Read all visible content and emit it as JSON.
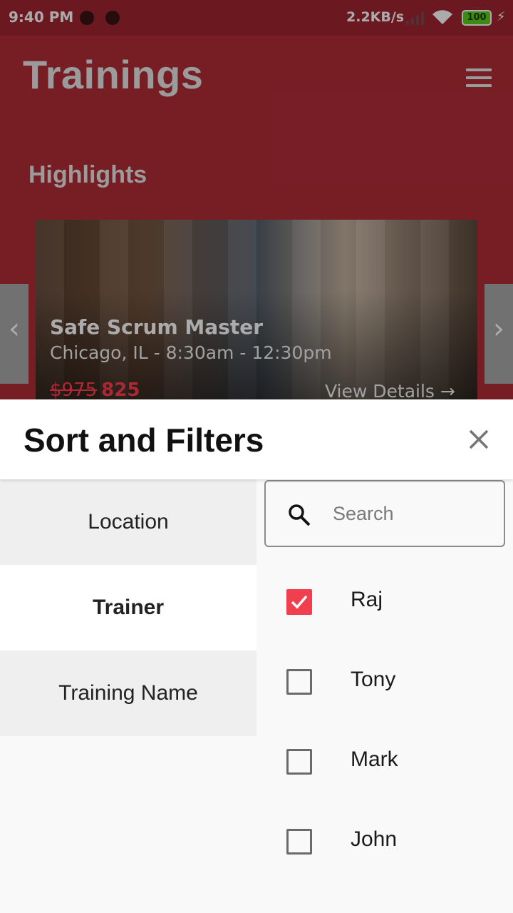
{
  "status_bar": {
    "time": "9:40 PM",
    "network_speed": "2.2KB/s",
    "battery": "100"
  },
  "app": {
    "title": "Trainings",
    "section": "Highlights",
    "featured": {
      "title": "Safe Scrum Master",
      "subtitle": "Chicago, IL - 8:30am - 12:30pm",
      "old_price": "$975",
      "price": "825",
      "cta": "View Details"
    }
  },
  "sheet": {
    "title": "Sort and Filters",
    "tabs": [
      {
        "label": "Location",
        "active": false
      },
      {
        "label": "Trainer",
        "active": true
      },
      {
        "label": "Training Name",
        "active": false
      }
    ],
    "search": {
      "placeholder": "Search",
      "value": ""
    },
    "options": [
      {
        "label": "Raj",
        "checked": true
      },
      {
        "label": "Tony",
        "checked": false
      },
      {
        "label": "Mark",
        "checked": false
      },
      {
        "label": "John",
        "checked": false
      }
    ]
  },
  "colors": {
    "brand_red": "#b22d38",
    "checkbox_checked": "#f0404f",
    "battery_green": "#5bd01b"
  },
  "icons": [
    "menu-icon",
    "search-icon",
    "close-icon",
    "chevron-left-icon",
    "chevron-right-icon",
    "wifi-icon",
    "signal-icon",
    "battery-icon"
  ]
}
